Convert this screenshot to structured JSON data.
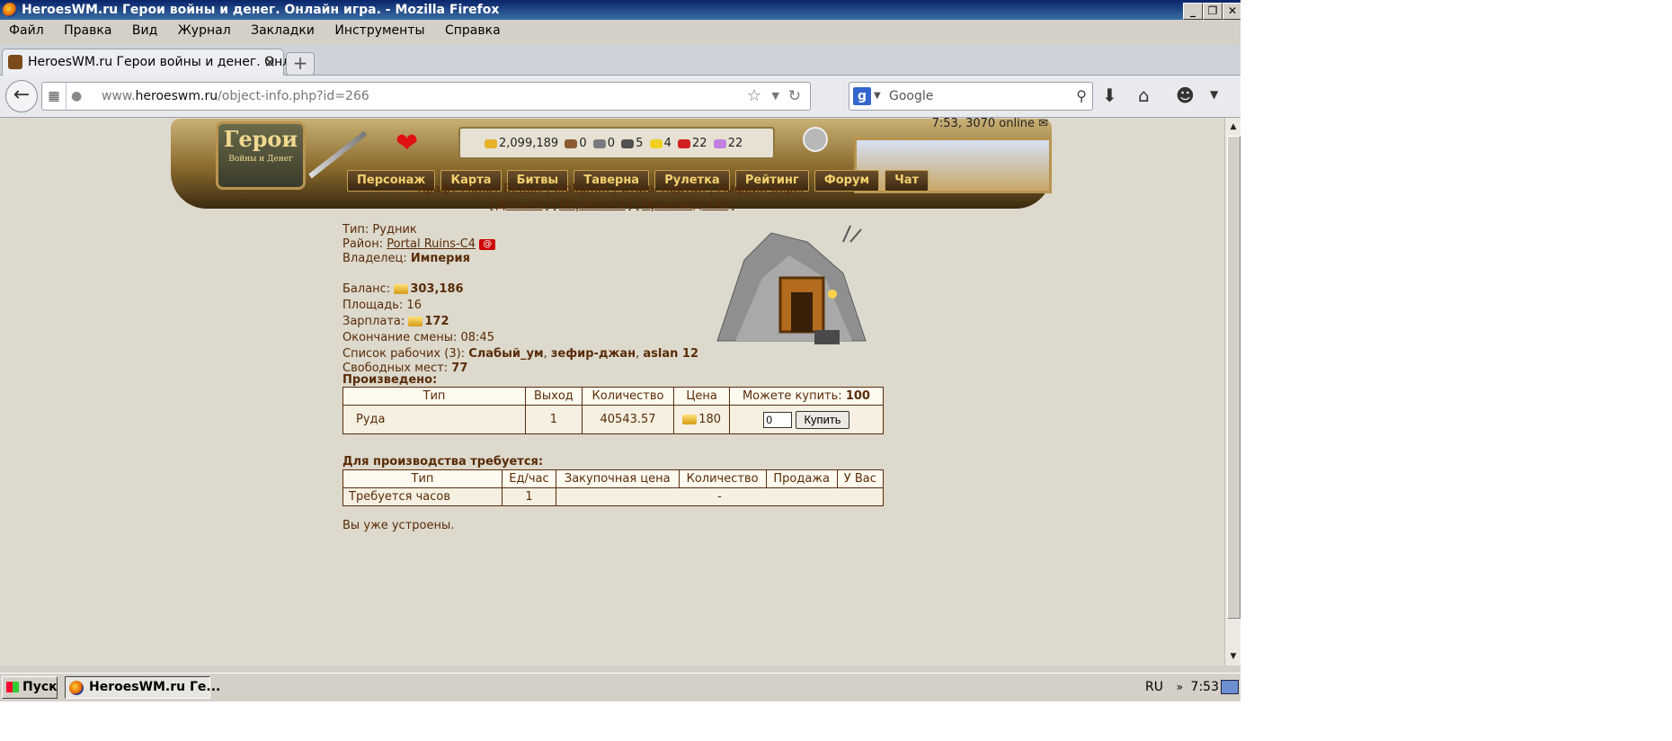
{
  "window": {
    "title": "HeroesWM.ru Герои войны и денег. Онлайн игра. - Mozilla Firefox",
    "controls": [
      "_",
      "❐",
      "✕"
    ]
  },
  "menu": [
    "Файл",
    "Правка",
    "Вид",
    "Журнал",
    "Закладки",
    "Инструменты",
    "Справка"
  ],
  "tab": {
    "label": "HeroesWM.ru Герои войны и денег. Онла...",
    "close": "✕",
    "new": "+"
  },
  "address": {
    "prefix": "www.",
    "domain": "heroeswm.ru",
    "path": "/object-info.php?id=266"
  },
  "search": {
    "engine": "g",
    "placeholder": "Google"
  },
  "game": {
    "logo_title": "Герои",
    "logo_sub": "Войны и Денег",
    "online": "7:53, 3070 online",
    "resources": {
      "gold": "2,099,189",
      "wood": "0",
      "ore": "0",
      "mercury": "5",
      "sulfur": "4",
      "crystal": "22",
      "gems": "22"
    },
    "nav": [
      "Персонаж",
      "Карта",
      "Битвы",
      "Таверна",
      "Рулетка",
      "Рейтинг",
      "Форум",
      "Чат"
    ]
  },
  "links1": "Крафт Молот Ведьм | emkgmm | Сталь Портал | Мифрил Берег",
  "links2": [
    "Добыча",
    "Обработка",
    "Производство"
  ],
  "info": {
    "type_label": "Тип:",
    "type_value": "Рудник",
    "district_label": "Район:",
    "district_value": "Portal Ruins-C4",
    "district_icon": "@",
    "owner_label": "Владелец:",
    "owner_value": "Империя",
    "balance_label": "Баланс:",
    "balance_value": "303,186",
    "area_label": "Площадь:",
    "area_value": "16",
    "salary_label": "Зарплата:",
    "salary_value": "172",
    "shift_label": "Окончание смены:",
    "shift_value": "08:45",
    "workers_label": "Список рабочих (3):",
    "workers": [
      "Слабый_ум",
      "зефир-джан",
      "aslan 12"
    ],
    "free_label": "Свободных мест:",
    "free_value": "77"
  },
  "produced": {
    "title": "Произведено:",
    "headers": [
      "Тип",
      "Выход",
      "Количество",
      "Цена",
      "Можете купить:"
    ],
    "can_buy_value": "100",
    "row": {
      "type": "Руда",
      "output": "1",
      "qty": "40543.57",
      "price": "180",
      "input_value": "0",
      "buy_label": "Купить"
    }
  },
  "required": {
    "title": "Для производства требуется:",
    "headers": [
      "Тип",
      "Ед/час",
      "Закупочная цена",
      "Количество",
      "Продажа",
      "У Вас"
    ],
    "row": {
      "type": "Требуется часов",
      "per_hour": "1",
      "dash": "-"
    }
  },
  "already": "Вы уже устроены.",
  "taskbar": {
    "start": "Пуск",
    "item": "HeroesWM.ru Ге...",
    "lang": "RU",
    "chevron": "»",
    "time": "7:53"
  },
  "colors": {
    "text": "#592c08",
    "page_bg": "#ddd9cd",
    "titlebar": "#0a246a"
  }
}
